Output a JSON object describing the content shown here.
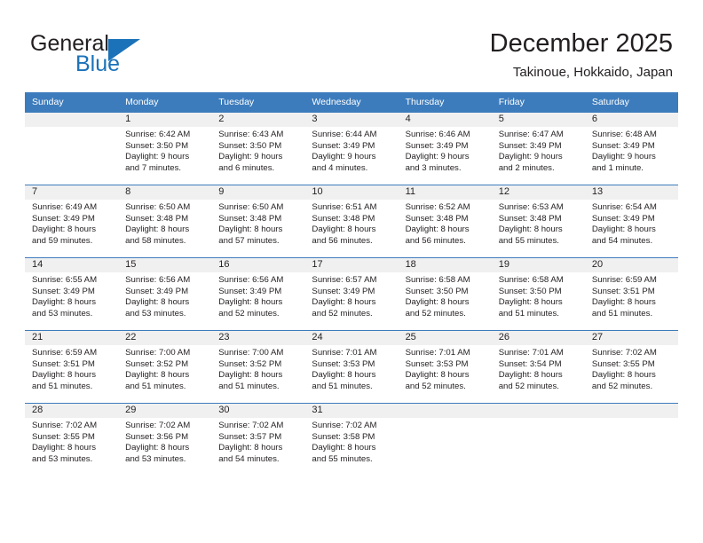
{
  "brand": {
    "name_part1": "General",
    "name_part2": "Blue",
    "accent_color": "#1b72b8"
  },
  "header": {
    "title": "December 2025",
    "subtitle": "Takinoue, Hokkaido, Japan"
  },
  "calendar": {
    "header_bg": "#3d7cbc",
    "weekday_headers": [
      "Sunday",
      "Monday",
      "Tuesday",
      "Wednesday",
      "Thursday",
      "Friday",
      "Saturday"
    ],
    "weeks": [
      [
        {
          "day": "",
          "sunrise": "",
          "sunset": "",
          "daylight1": "",
          "daylight2": ""
        },
        {
          "day": "1",
          "sunrise": "Sunrise: 6:42 AM",
          "sunset": "Sunset: 3:50 PM",
          "daylight1": "Daylight: 9 hours",
          "daylight2": "and 7 minutes."
        },
        {
          "day": "2",
          "sunrise": "Sunrise: 6:43 AM",
          "sunset": "Sunset: 3:50 PM",
          "daylight1": "Daylight: 9 hours",
          "daylight2": "and 6 minutes."
        },
        {
          "day": "3",
          "sunrise": "Sunrise: 6:44 AM",
          "sunset": "Sunset: 3:49 PM",
          "daylight1": "Daylight: 9 hours",
          "daylight2": "and 4 minutes."
        },
        {
          "day": "4",
          "sunrise": "Sunrise: 6:46 AM",
          "sunset": "Sunset: 3:49 PM",
          "daylight1": "Daylight: 9 hours",
          "daylight2": "and 3 minutes."
        },
        {
          "day": "5",
          "sunrise": "Sunrise: 6:47 AM",
          "sunset": "Sunset: 3:49 PM",
          "daylight1": "Daylight: 9 hours",
          "daylight2": "and 2 minutes."
        },
        {
          "day": "6",
          "sunrise": "Sunrise: 6:48 AM",
          "sunset": "Sunset: 3:49 PM",
          "daylight1": "Daylight: 9 hours",
          "daylight2": "and 1 minute."
        }
      ],
      [
        {
          "day": "7",
          "sunrise": "Sunrise: 6:49 AM",
          "sunset": "Sunset: 3:49 PM",
          "daylight1": "Daylight: 8 hours",
          "daylight2": "and 59 minutes."
        },
        {
          "day": "8",
          "sunrise": "Sunrise: 6:50 AM",
          "sunset": "Sunset: 3:48 PM",
          "daylight1": "Daylight: 8 hours",
          "daylight2": "and 58 minutes."
        },
        {
          "day": "9",
          "sunrise": "Sunrise: 6:50 AM",
          "sunset": "Sunset: 3:48 PM",
          "daylight1": "Daylight: 8 hours",
          "daylight2": "and 57 minutes."
        },
        {
          "day": "10",
          "sunrise": "Sunrise: 6:51 AM",
          "sunset": "Sunset: 3:48 PM",
          "daylight1": "Daylight: 8 hours",
          "daylight2": "and 56 minutes."
        },
        {
          "day": "11",
          "sunrise": "Sunrise: 6:52 AM",
          "sunset": "Sunset: 3:48 PM",
          "daylight1": "Daylight: 8 hours",
          "daylight2": "and 56 minutes."
        },
        {
          "day": "12",
          "sunrise": "Sunrise: 6:53 AM",
          "sunset": "Sunset: 3:48 PM",
          "daylight1": "Daylight: 8 hours",
          "daylight2": "and 55 minutes."
        },
        {
          "day": "13",
          "sunrise": "Sunrise: 6:54 AM",
          "sunset": "Sunset: 3:49 PM",
          "daylight1": "Daylight: 8 hours",
          "daylight2": "and 54 minutes."
        }
      ],
      [
        {
          "day": "14",
          "sunrise": "Sunrise: 6:55 AM",
          "sunset": "Sunset: 3:49 PM",
          "daylight1": "Daylight: 8 hours",
          "daylight2": "and 53 minutes."
        },
        {
          "day": "15",
          "sunrise": "Sunrise: 6:56 AM",
          "sunset": "Sunset: 3:49 PM",
          "daylight1": "Daylight: 8 hours",
          "daylight2": "and 53 minutes."
        },
        {
          "day": "16",
          "sunrise": "Sunrise: 6:56 AM",
          "sunset": "Sunset: 3:49 PM",
          "daylight1": "Daylight: 8 hours",
          "daylight2": "and 52 minutes."
        },
        {
          "day": "17",
          "sunrise": "Sunrise: 6:57 AM",
          "sunset": "Sunset: 3:49 PM",
          "daylight1": "Daylight: 8 hours",
          "daylight2": "and 52 minutes."
        },
        {
          "day": "18",
          "sunrise": "Sunrise: 6:58 AM",
          "sunset": "Sunset: 3:50 PM",
          "daylight1": "Daylight: 8 hours",
          "daylight2": "and 52 minutes."
        },
        {
          "day": "19",
          "sunrise": "Sunrise: 6:58 AM",
          "sunset": "Sunset: 3:50 PM",
          "daylight1": "Daylight: 8 hours",
          "daylight2": "and 51 minutes."
        },
        {
          "day": "20",
          "sunrise": "Sunrise: 6:59 AM",
          "sunset": "Sunset: 3:51 PM",
          "daylight1": "Daylight: 8 hours",
          "daylight2": "and 51 minutes."
        }
      ],
      [
        {
          "day": "21",
          "sunrise": "Sunrise: 6:59 AM",
          "sunset": "Sunset: 3:51 PM",
          "daylight1": "Daylight: 8 hours",
          "daylight2": "and 51 minutes."
        },
        {
          "day": "22",
          "sunrise": "Sunrise: 7:00 AM",
          "sunset": "Sunset: 3:52 PM",
          "daylight1": "Daylight: 8 hours",
          "daylight2": "and 51 minutes."
        },
        {
          "day": "23",
          "sunrise": "Sunrise: 7:00 AM",
          "sunset": "Sunset: 3:52 PM",
          "daylight1": "Daylight: 8 hours",
          "daylight2": "and 51 minutes."
        },
        {
          "day": "24",
          "sunrise": "Sunrise: 7:01 AM",
          "sunset": "Sunset: 3:53 PM",
          "daylight1": "Daylight: 8 hours",
          "daylight2": "and 51 minutes."
        },
        {
          "day": "25",
          "sunrise": "Sunrise: 7:01 AM",
          "sunset": "Sunset: 3:53 PM",
          "daylight1": "Daylight: 8 hours",
          "daylight2": "and 52 minutes."
        },
        {
          "day": "26",
          "sunrise": "Sunrise: 7:01 AM",
          "sunset": "Sunset: 3:54 PM",
          "daylight1": "Daylight: 8 hours",
          "daylight2": "and 52 minutes."
        },
        {
          "day": "27",
          "sunrise": "Sunrise: 7:02 AM",
          "sunset": "Sunset: 3:55 PM",
          "daylight1": "Daylight: 8 hours",
          "daylight2": "and 52 minutes."
        }
      ],
      [
        {
          "day": "28",
          "sunrise": "Sunrise: 7:02 AM",
          "sunset": "Sunset: 3:55 PM",
          "daylight1": "Daylight: 8 hours",
          "daylight2": "and 53 minutes."
        },
        {
          "day": "29",
          "sunrise": "Sunrise: 7:02 AM",
          "sunset": "Sunset: 3:56 PM",
          "daylight1": "Daylight: 8 hours",
          "daylight2": "and 53 minutes."
        },
        {
          "day": "30",
          "sunrise": "Sunrise: 7:02 AM",
          "sunset": "Sunset: 3:57 PM",
          "daylight1": "Daylight: 8 hours",
          "daylight2": "and 54 minutes."
        },
        {
          "day": "31",
          "sunrise": "Sunrise: 7:02 AM",
          "sunset": "Sunset: 3:58 PM",
          "daylight1": "Daylight: 8 hours",
          "daylight2": "and 55 minutes."
        },
        {
          "day": "",
          "sunrise": "",
          "sunset": "",
          "daylight1": "",
          "daylight2": ""
        },
        {
          "day": "",
          "sunrise": "",
          "sunset": "",
          "daylight1": "",
          "daylight2": ""
        },
        {
          "day": "",
          "sunrise": "",
          "sunset": "",
          "daylight1": "",
          "daylight2": ""
        }
      ]
    ]
  }
}
